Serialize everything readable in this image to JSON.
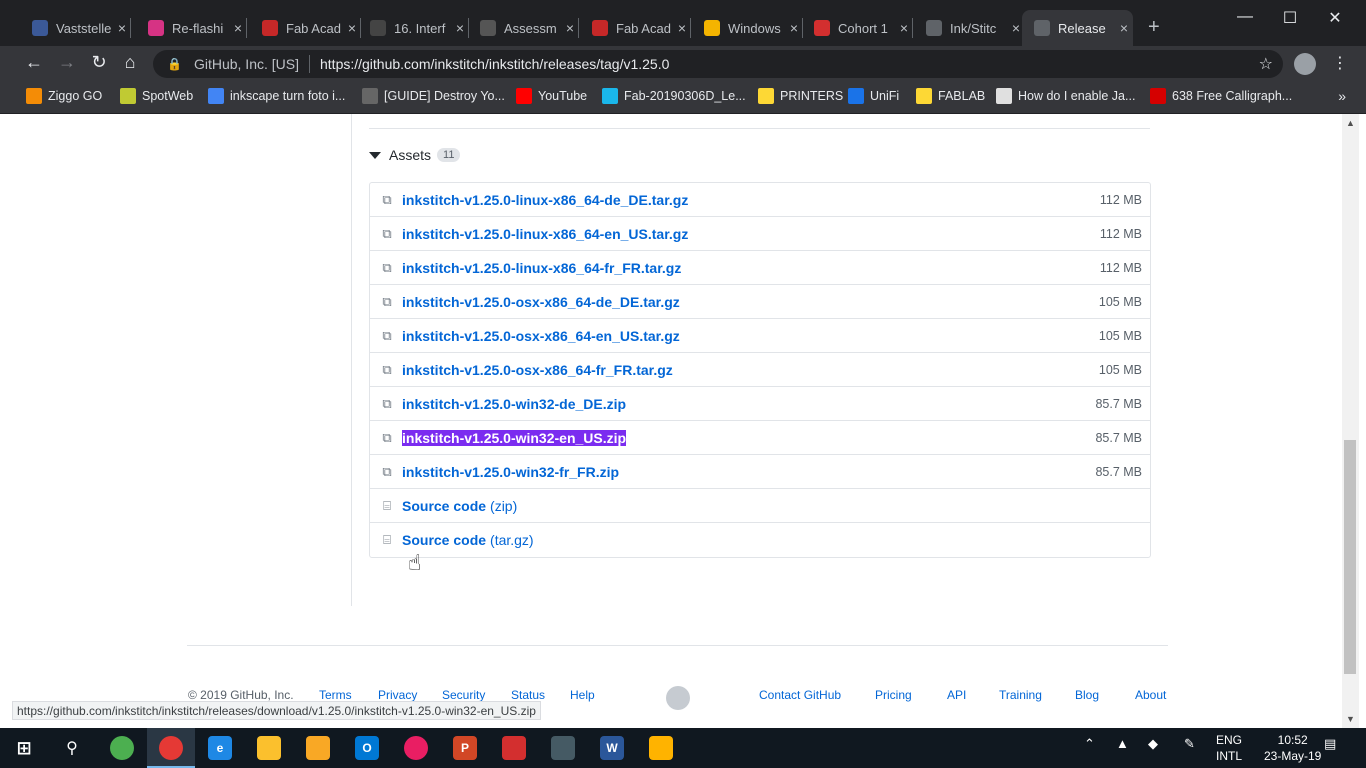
{
  "browser": {
    "tabs": [
      {
        "title": "Vaststelle",
        "icon": "vaststelling-icon",
        "color": "#3b5998"
      },
      {
        "title": "Re-flashi",
        "icon": "reflash-icon",
        "color": "#d63384"
      },
      {
        "title": "Fab Acad",
        "icon": "fab-academy-icon",
        "color": "#c62828"
      },
      {
        "title": "16. Interf",
        "icon": "document-icon",
        "color": "#444444"
      },
      {
        "title": "Assessm",
        "icon": "assessment-icon",
        "color": "#555555"
      },
      {
        "title": "Fab Acad",
        "icon": "fab-academy-icon",
        "color": "#c62828"
      },
      {
        "title": "Windows",
        "icon": "windows-icon",
        "color": "#f4b400"
      },
      {
        "title": "Cohort 1",
        "icon": "cohort-icon",
        "color": "#d32f2f"
      },
      {
        "title": "Ink/Stitc",
        "icon": "inkstitch-icon",
        "color": "#5f6368"
      },
      {
        "title": "Release",
        "icon": "github-icon",
        "color": "#5f6368"
      }
    ],
    "omnibox": {
      "org": "GitHub, Inc. [US]",
      "url": "https://github.com/inkstitch/inkstitch/releases/tag/v1.25.0"
    },
    "bookmarks": [
      {
        "label": "Ziggo GO",
        "icon": "ziggo-icon",
        "color": "#f48c06"
      },
      {
        "label": "SpotWeb",
        "icon": "spotweb-icon",
        "color": "#c0ca33"
      },
      {
        "label": "inkscape turn foto i...",
        "icon": "google-icon",
        "color": "#4285f4"
      },
      {
        "label": "[GUIDE] Destroy Yo...",
        "icon": "guide-icon",
        "color": "#666666"
      },
      {
        "label": "YouTube",
        "icon": "youtube-icon",
        "color": "#ff0000"
      },
      {
        "label": "Fab-20190306D_Le...",
        "icon": "vimeo-icon",
        "color": "#1ab7ea"
      },
      {
        "label": "PRINTERS",
        "icon": "folder-icon",
        "color": "#fdd835"
      },
      {
        "label": "UniFi",
        "icon": "unifi-icon",
        "color": "#1a73e8"
      },
      {
        "label": "FABLAB",
        "icon": "folder-icon",
        "color": "#fdd835"
      },
      {
        "label": "How do I enable Ja...",
        "icon": "java-icon",
        "color": "#e0e0e0"
      },
      {
        "label": "638 Free Calligraph...",
        "icon": "font-icon",
        "color": "#d50000"
      }
    ]
  },
  "assets": {
    "heading": "Assets",
    "count": "11",
    "files": [
      {
        "name": "inkstitch-v1.25.0-linux-x86_64-de_DE.tar.gz",
        "size": "112 MB"
      },
      {
        "name": "inkstitch-v1.25.0-linux-x86_64-en_US.tar.gz",
        "size": "112 MB"
      },
      {
        "name": "inkstitch-v1.25.0-linux-x86_64-fr_FR.tar.gz",
        "size": "112 MB"
      },
      {
        "name": "inkstitch-v1.25.0-osx-x86_64-de_DE.tar.gz",
        "size": "105 MB"
      },
      {
        "name": "inkstitch-v1.25.0-osx-x86_64-en_US.tar.gz",
        "size": "105 MB"
      },
      {
        "name": "inkstitch-v1.25.0-osx-x86_64-fr_FR.tar.gz",
        "size": "105 MB"
      },
      {
        "name": "inkstitch-v1.25.0-win32-de_DE.zip",
        "size": "85.7 MB"
      },
      {
        "name": "inkstitch-v1.25.0-win32-en_US.zip",
        "size": "85.7 MB"
      },
      {
        "name": "inkstitch-v1.25.0-win32-fr_FR.zip",
        "size": "85.7 MB"
      }
    ],
    "source": [
      {
        "label": "Source code",
        "format": "(zip)"
      },
      {
        "label": "Source code",
        "format": "(tar.gz)"
      }
    ]
  },
  "footer": {
    "copyright": "© 2019 GitHub, Inc.",
    "links_left": [
      "Terms",
      "Privacy",
      "Security",
      "Status",
      "Help"
    ],
    "links_right": [
      "Contact GitHub",
      "Pricing",
      "API",
      "Training",
      "Blog",
      "About"
    ]
  },
  "status_url": "https://github.com/inkstitch/inkstitch/releases/download/v1.25.0/inkstitch-v1.25.0-win32-en_US.zip",
  "taskbar": {
    "language_top": "ENG",
    "language_bottom": "INTL",
    "time": "10:52",
    "date": "23-May-19"
  }
}
